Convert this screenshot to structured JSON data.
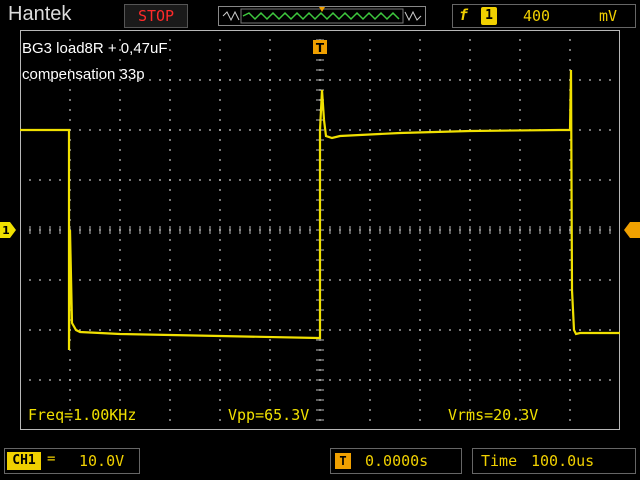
{
  "brand": "Hantek",
  "run_state": "STOP",
  "trigger": {
    "edge_symbol": "f",
    "channel": "1",
    "level": "400",
    "unit": "mV"
  },
  "notes": {
    "line1": "BG3 load8R + 0,47uF",
    "line2": "compensation 33p"
  },
  "markers": {
    "trigger_top": "T",
    "channel_left": "1"
  },
  "measurements": {
    "freq": "Freq=1.00KHz",
    "vpp": "Vpp=65.3V",
    "vrms": "Vrms=20.3V"
  },
  "channel": {
    "label": "CH1",
    "coupling_symbol": "=",
    "scale": "10.0V"
  },
  "horizontal": {
    "position_icon": "T",
    "position": "0.0000s",
    "time_label": "Time",
    "time_value": "100.0us"
  },
  "colors": {
    "trace": "#f0e000",
    "trigger": "#f0a000",
    "grid": "#b8b8b8",
    "stop": "#ff2a2a"
  }
}
